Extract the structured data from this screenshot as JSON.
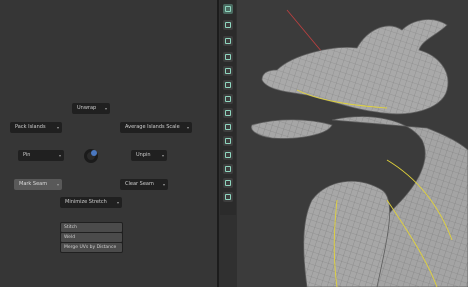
{
  "pie_menu": {
    "unwrap": "Unwrap",
    "pack_islands": "Pack Islands",
    "average_islands_scale": "Average Islands Scale",
    "pin": "Pin",
    "unpin": "Unpin",
    "mark_seam": "Mark Seam",
    "clear_seam": "Clear Seam",
    "minimize_stretch": "Minimize Stretch",
    "sub_items": [
      "Stitch",
      "Weld",
      "Merge UVs by Distance"
    ]
  },
  "toolbar": {
    "tools": [
      "select-box-icon",
      "cursor-icon",
      "move-icon",
      "rotate-icon",
      "scale-icon",
      "transform-icon",
      "annotate-icon",
      "measure-icon",
      "extrude-icon",
      "inset-icon",
      "bevel-icon",
      "loop-cut-icon",
      "knife-icon",
      "poly-build-icon",
      "spin-icon",
      "smooth-icon",
      "shear-icon",
      "rip-icon",
      "shrink-icon",
      "sphere-icon"
    ]
  },
  "colors": {
    "accent": "#8fd6bf",
    "mesh": "#9a9a9a",
    "seam": "#e0d23a",
    "axis": "#c04040"
  }
}
